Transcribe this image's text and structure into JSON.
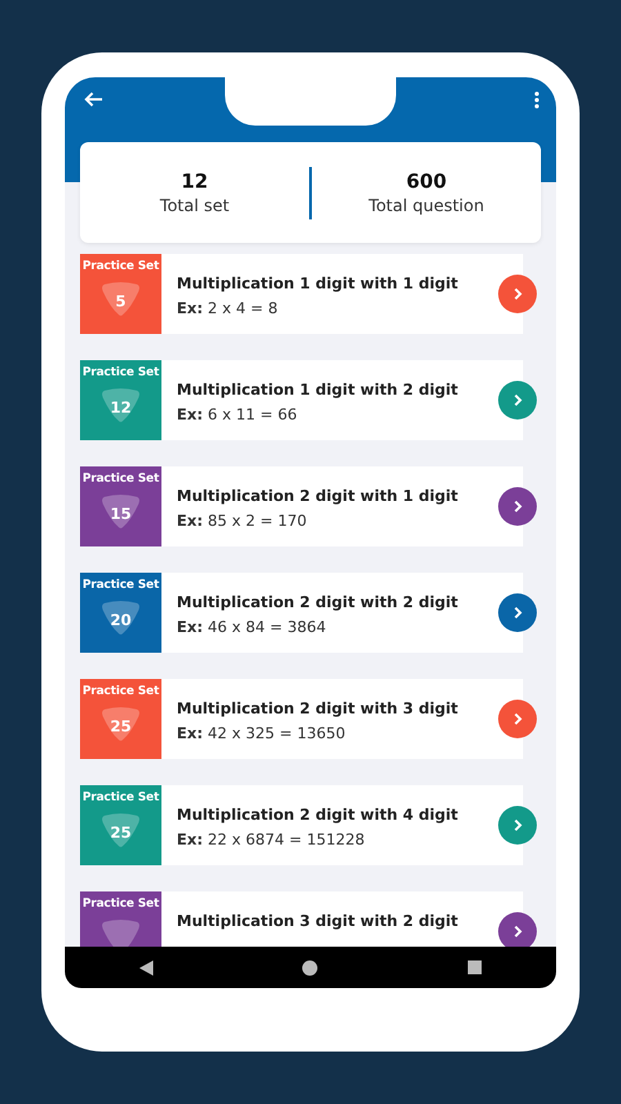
{
  "stats": [
    {
      "value": "12",
      "label": "Total set"
    },
    {
      "value": "600",
      "label": "Total question"
    }
  ],
  "sets": [
    {
      "badge": "Practice Set",
      "number": "5",
      "title": "Multiplication 1 digit with 1 digit",
      "example": "**Ex:** 2 x 4 = 8",
      "color": "#f4533a"
    },
    {
      "badge": "Practice Set",
      "number": "12",
      "title": "Multiplication 1 digit with 2 digit",
      "example": "**Ex:** 6 x 11 = 66",
      "color": "#139a8a"
    },
    {
      "badge": "Practice Set",
      "number": "15",
      "title": "Multiplication 2 digit with 1 digit",
      "example": "**Ex:** 85 x 2 = 170",
      "color": "#7b3f98"
    },
    {
      "badge": "Practice Set",
      "number": "20",
      "title": "Multiplication 2 digit with 2 digit",
      "example": "**Ex:** 46 x 84 = 3864",
      "color": "#0a66a8"
    },
    {
      "badge": "Practice Set",
      "number": "25",
      "title": "Multiplication 2 digit with 3 digit",
      "example": "**Ex:** 42 x 325 = 13650",
      "color": "#f4533a"
    },
    {
      "badge": "Practice Set",
      "number": "25",
      "title": "Multiplication 2 digit with 4 digit",
      "example": "**Ex:** 22 x 6874 = 151228",
      "color": "#139a8a"
    },
    {
      "badge": "Practice Set",
      "title": "Multiplication 3 digit with 2 digit",
      "color": "#7b3f98"
    }
  ]
}
